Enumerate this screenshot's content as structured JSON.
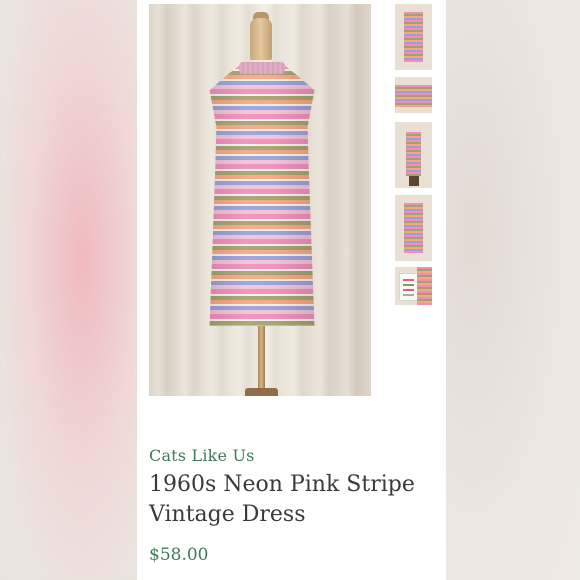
{
  "listing": {
    "seller": "Cats Like Us",
    "title": "1960s Neon Pink Stripe Vintage Dress",
    "price": "$58.00"
  },
  "photos": {
    "main": "dress-on-mannequin",
    "thumbnails": [
      "dress-front",
      "dress-waist-detail",
      "dress-back",
      "dress-side",
      "price-tag-detail"
    ]
  },
  "colors": {
    "accent": "#3f7a55",
    "title_text": "#3a3a3a",
    "stripe_pink": "#ef8fb8",
    "stripe_olive": "#a3a26c",
    "stripe_orange": "#f7a585",
    "stripe_lavender": "#9aa0d6"
  }
}
